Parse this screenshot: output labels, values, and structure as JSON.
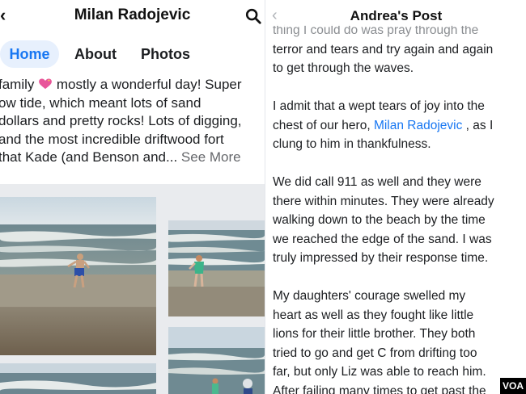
{
  "left": {
    "header": {
      "back_icon": "‹",
      "title": "Milan Radojevic",
      "search_icon": "search-icon"
    },
    "tabs": [
      {
        "label": "Home"
      },
      {
        "label": "About"
      },
      {
        "label": "Photos"
      }
    ],
    "post": {
      "line1a": "family",
      "line1b": " mostly a wonderful day! Super",
      "line2": "ow tide, which meant lots of sand",
      "line3": "dollars and pretty rocks! Lots of digging,",
      "line4": "and the most incredible driftwood fort",
      "line5": "that Kade (and Benson and...",
      "see_more": " See More"
    }
  },
  "right": {
    "header": {
      "back_icon": "‹",
      "title": "Andrea's Post"
    },
    "lines": {
      "cut": "thing I could do was pray through the",
      "p1_1": "terror and tears and try again and again",
      "p1_2": "to get through the waves.",
      "p2_1": "I admit that a wept tears of joy into the",
      "p2_2a": "chest of our hero, ",
      "p2_2link": "Milan Radojevic",
      "p2_2b": " , as I",
      "p2_3": "clung to him in thankfulness.",
      "p3_1": "We did call 911 as well and they were",
      "p3_2": "there within minutes. They were already",
      "p3_3": "walking down to the beach by the time",
      "p3_4": "we reached the edge of the sand. I was",
      "p3_5": "truly impressed by their response time.",
      "p4_1": "My daughters' courage swelled my",
      "p4_2": "heart as well as they fought like little",
      "p4_3": "lions for their little brother. They both",
      "p4_4": "tried to go and get C from drifting too",
      "p4_5": "far, but only Liz was able to reach him.",
      "p4_6": "After failing many times to get past the"
    }
  },
  "watermark": "VOA",
  "colors": {
    "accent": "#1877f2",
    "active_tab_bg": "#e7f0fd",
    "secondary_text": "#65676b"
  }
}
